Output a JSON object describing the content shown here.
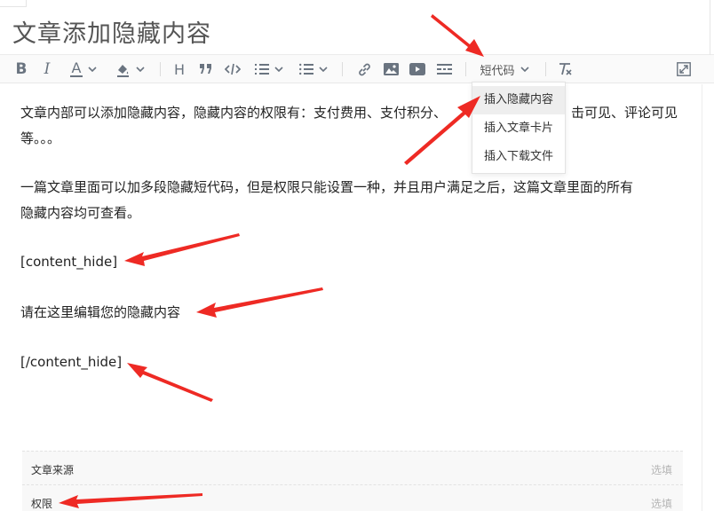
{
  "page": {
    "title": "文章添加隐藏内容"
  },
  "toolbar": {
    "bold": "B",
    "italic": "I",
    "font_color": "A",
    "heading": "H",
    "shortcode_label": "短代码"
  },
  "shortcode_menu": {
    "items": [
      "插入隐藏内容",
      "插入文章卡片",
      "插入下载文件"
    ],
    "highlighted": "插入隐藏内容"
  },
  "editor": {
    "paragraphs": [
      "文章内部可以添加隐藏内容，隐藏内容的权限有：支付费用、支付积分、",
      "等。。。",
      "击可见、评论可见",
      "一篇文章里面可以加多段隐藏短代码，但是权限只能设置一种，并且用户满足之后，这篇文章里面的所有",
      "隐藏内容均可查看。",
      "[content_hide]",
      "请在这里编辑您的隐藏内容",
      "[/content_hide]"
    ]
  },
  "meta_fields": [
    {
      "label": "文章来源",
      "hint": "选填"
    },
    {
      "label": "权限",
      "hint": "选填"
    }
  ],
  "colors": {
    "arrow": "#ee2a24",
    "icon": "#6a7480",
    "menu_highlight": "#eeeeee"
  },
  "icons": [
    "bold-icon",
    "italic-icon",
    "font-color-icon",
    "highlight-icon",
    "heading-icon",
    "quote-icon",
    "code-icon",
    "ordered-list-icon",
    "unordered-list-icon",
    "link-icon",
    "image-icon",
    "video-icon",
    "divider-icon",
    "clear-format-icon",
    "fullscreen-icon"
  ]
}
